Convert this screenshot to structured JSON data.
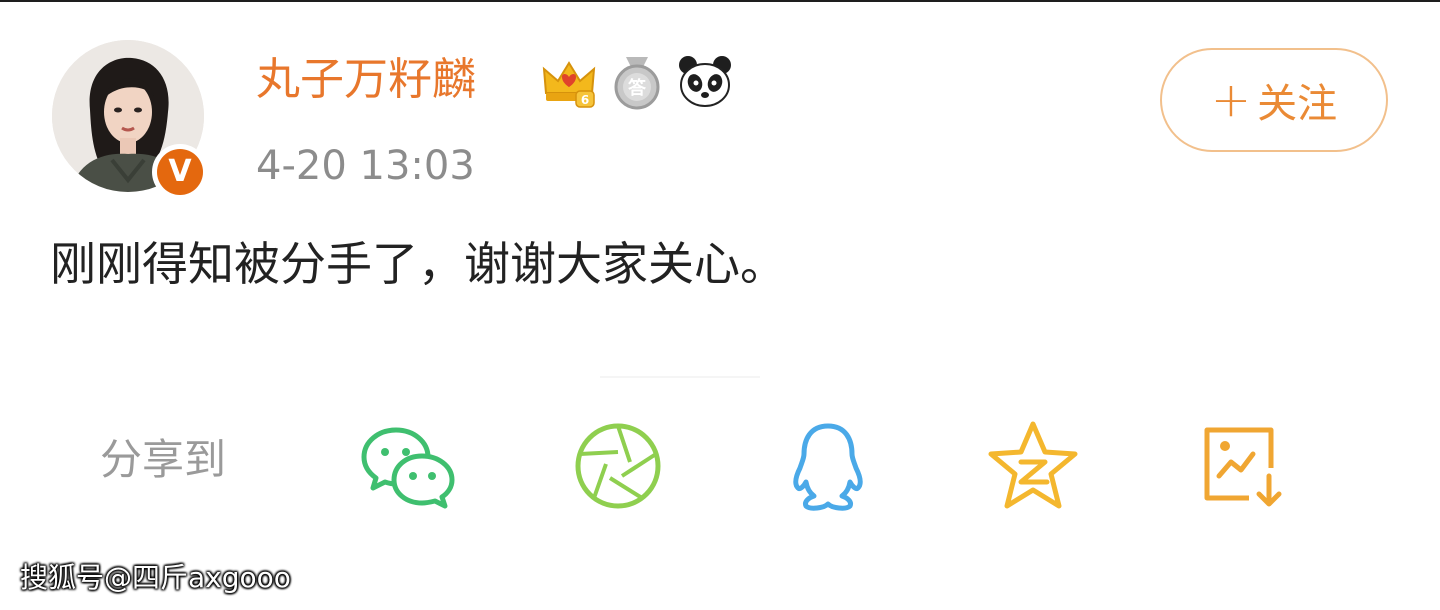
{
  "post": {
    "username": "丸子万籽麟",
    "timestamp": "4-20 13:03",
    "text": "刚刚得知被分手了，谢谢大家关心。",
    "verified_badge": "V",
    "follow_label": "关注",
    "follow_plus": "+"
  },
  "badges": [
    {
      "name": "crown-level-icon",
      "level": "6"
    },
    {
      "name": "answer-medal-icon",
      "text": "答"
    },
    {
      "name": "panda-icon"
    }
  ],
  "share": {
    "label": "分享到",
    "targets": [
      "wechat",
      "moments",
      "qq",
      "qzone",
      "save-image"
    ]
  },
  "watermark": "搜狐号@四斤axgooo",
  "colors": {
    "username": "#e8772c",
    "follow": "#ea8a35",
    "wechat": "#3fbf6f",
    "moments": "#8fcf4f",
    "qq": "#4aa9e8",
    "qzone": "#f4b72e",
    "save": "#f0a632"
  }
}
